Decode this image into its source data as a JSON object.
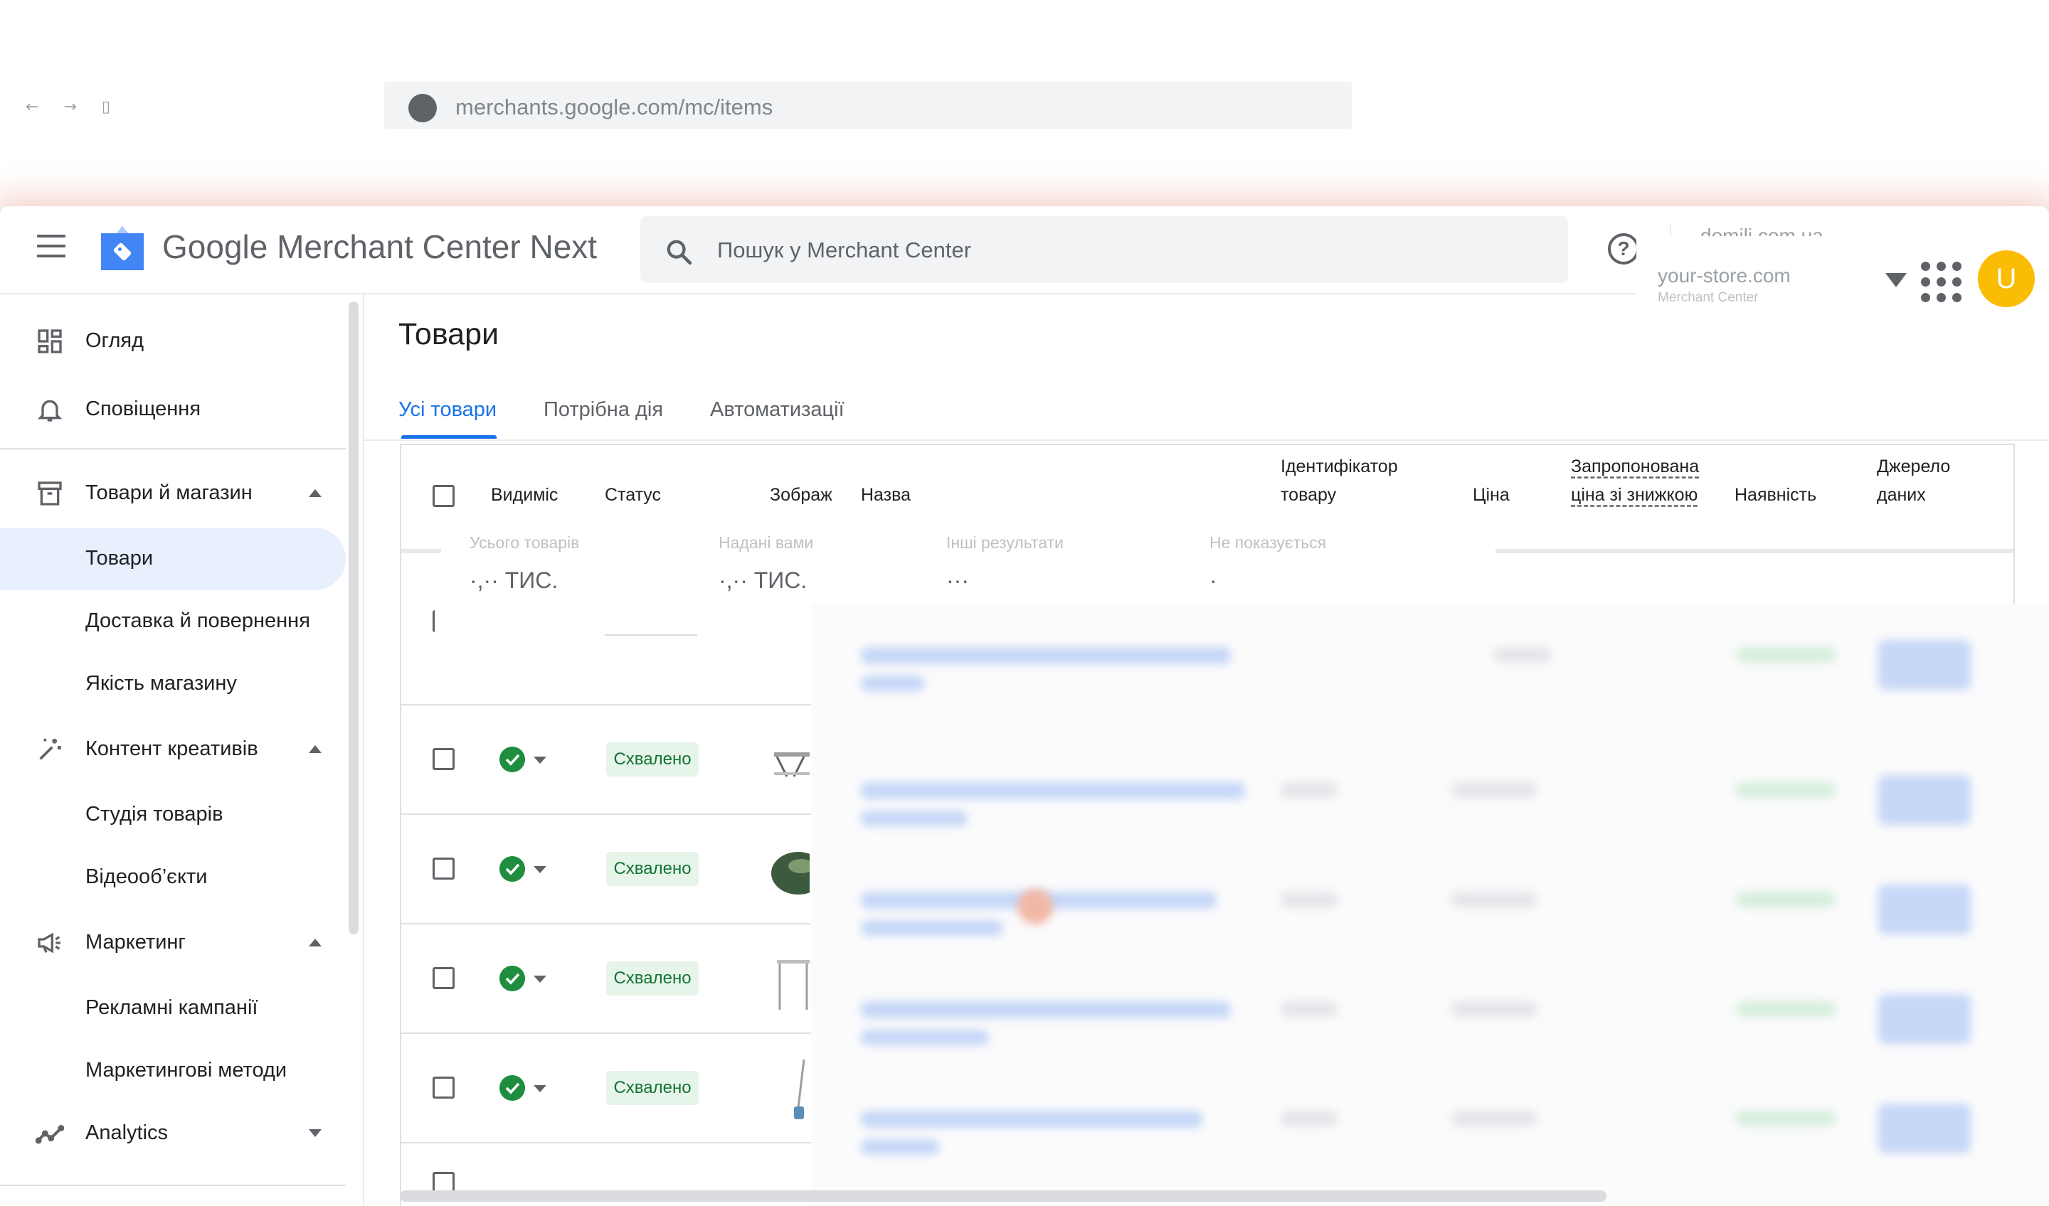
{
  "browser": {
    "nav_arrows": "← → ▯",
    "url": "merchants.google.com/mc/items"
  },
  "header": {
    "product_name": "Google Merchant Center Next",
    "search_placeholder": "Пошук у Merchant Center",
    "account_background": "domili.com.ua",
    "account_name": "your-store.com",
    "account_sub": "Merchant Center",
    "avatar_letter": "U"
  },
  "sidebar": {
    "overview": "Огляд",
    "notifications": "Сповіщення",
    "products_store": "Товари й магазин",
    "products": "Товари",
    "shipping": "Доставка й повернення",
    "store_quality": "Якість магазину",
    "creative_content": "Контент креативів",
    "product_studio": "Студія товарів",
    "video_assets": "Відеооб’єкти",
    "marketing": "Маркетинг",
    "ad_campaigns": "Рекламні кампанії",
    "marketing_methods": "Маркетингові методи",
    "analytics": "Analytics"
  },
  "main": {
    "title": "Товари",
    "tabs": [
      "Усі товари",
      "Потрібна дія",
      "Автоматизації"
    ],
    "columns": {
      "visibility": "Видиміс",
      "status": "Статус",
      "image": "Зображ",
      "name": "Назва",
      "id_line1": "Ідентифікатор",
      "id_line2": "товару",
      "price": "Ціна",
      "sale_line1": "Запропонована",
      "sale_line2": "ціна зі знижкою",
      "availability": "Наявність",
      "source_line1": "Джерело",
      "source_line2": "даних"
    },
    "summary": {
      "total_label": "Усього товарів",
      "total_value": "·,·· ТИС.",
      "provided_label": "Надані вами",
      "provided_value": "·,·· ТИС.",
      "other_label": "Інші результати",
      "other_value": "···",
      "not_shown_label": "Не показується",
      "not_shown_value": "·"
    },
    "rows": [
      {
        "status": "Схвалено"
      },
      {
        "status": "Схвалено"
      },
      {
        "status": "Схвалено"
      },
      {
        "status": "Схвалено"
      }
    ]
  },
  "colors": {
    "accent": "#1a73e8",
    "approved_bg": "#e6f4ea",
    "approved_text": "#137333",
    "visible_green": "#1e8e3e",
    "avatar": "#fbbc04"
  }
}
